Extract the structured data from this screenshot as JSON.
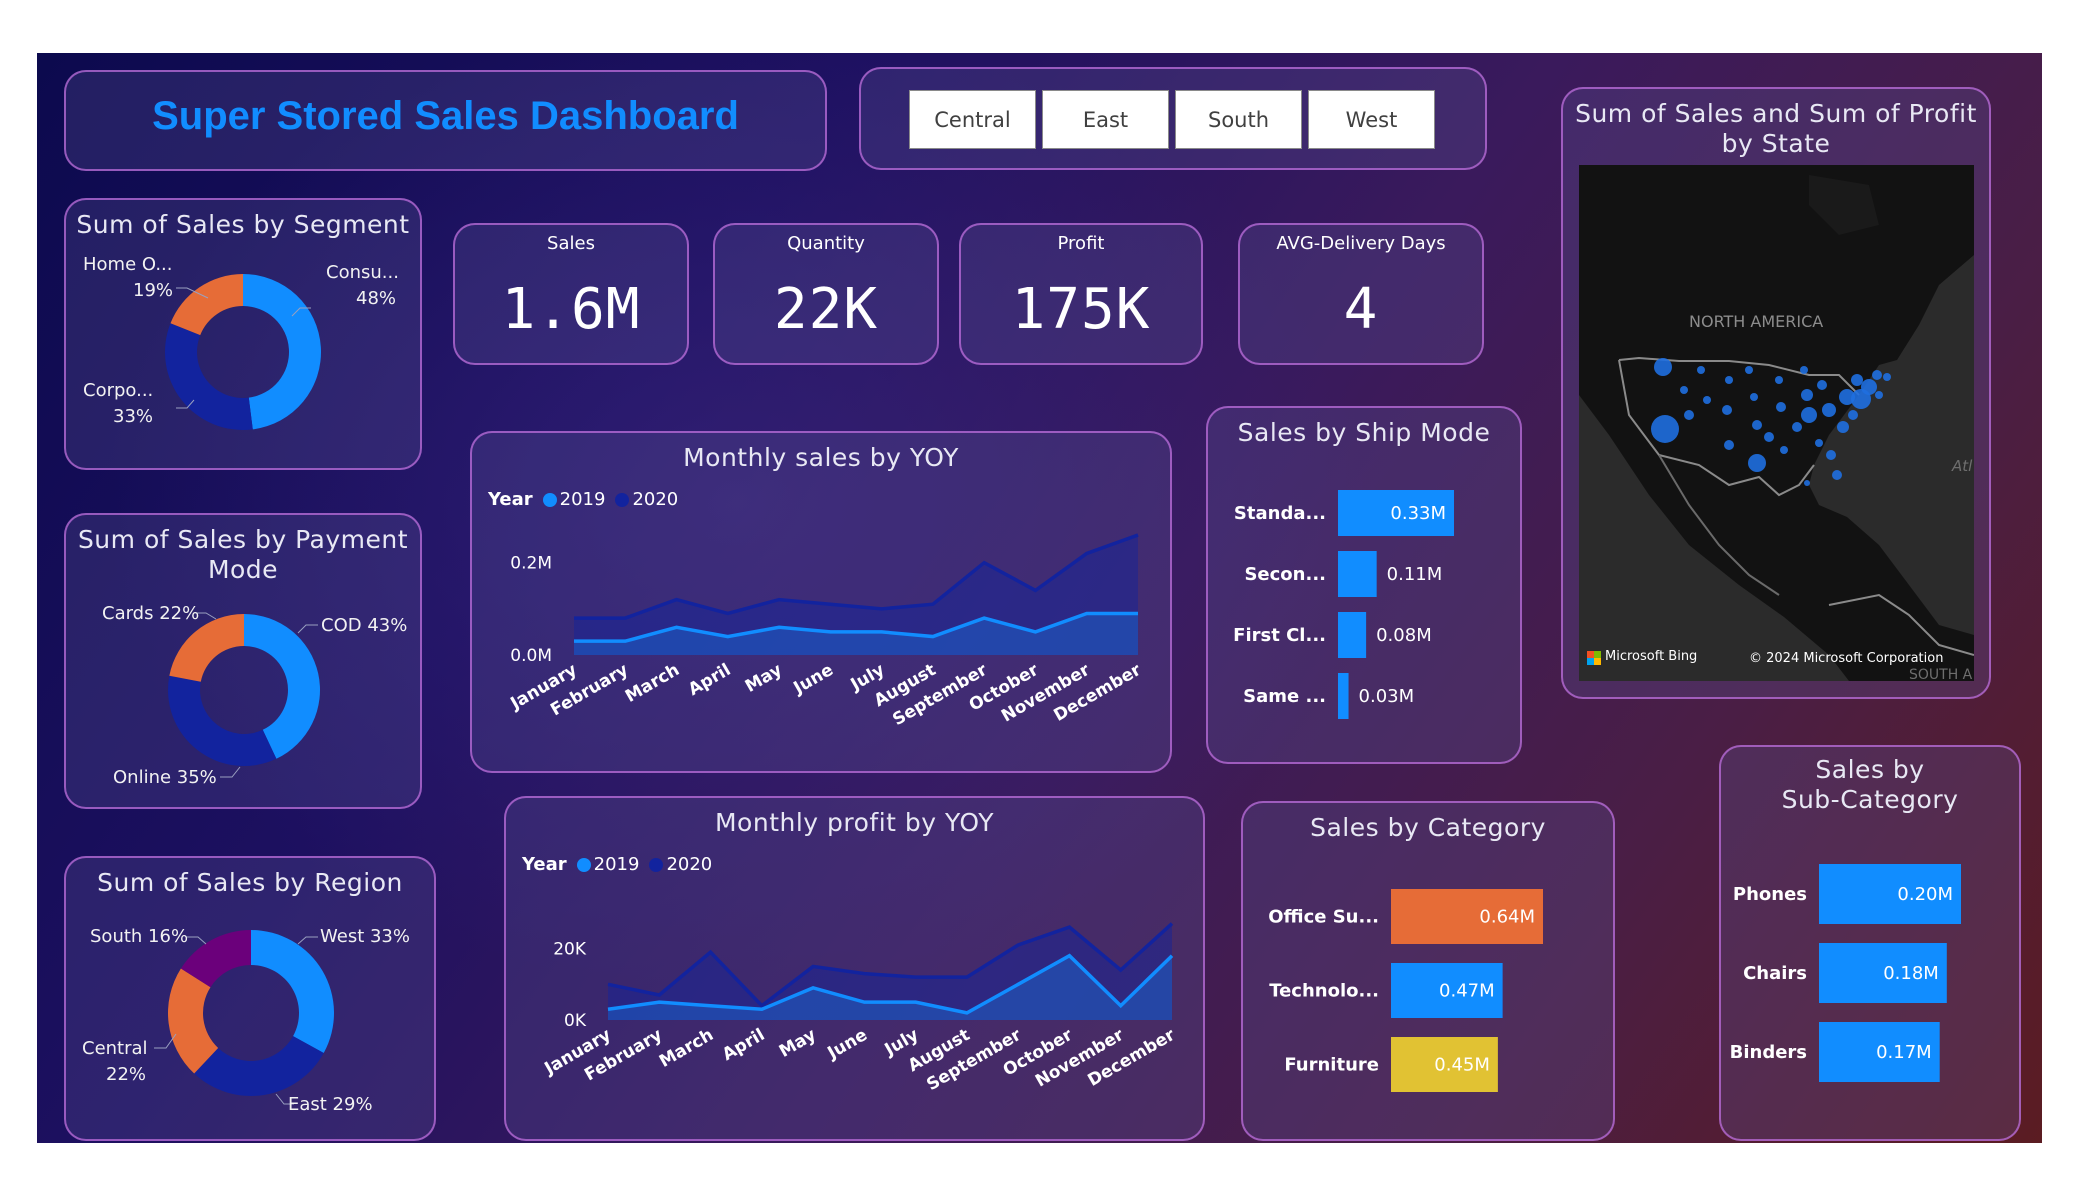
{
  "title": "Super Stored Sales Dashboard",
  "slicer": {
    "options": [
      "Central",
      "East",
      "South",
      "West"
    ]
  },
  "kpis": [
    {
      "label": "Sales",
      "value": "1.6M"
    },
    {
      "label": "Quantity",
      "value": "22K"
    },
    {
      "label": "Profit",
      "value": "175K"
    },
    {
      "label": "AVG-Delivery Days",
      "value": "4"
    }
  ],
  "colors": {
    "blue": "#118dff",
    "navy": "#12239e",
    "orange": "#e66c37",
    "purple": "#6b007b",
    "yellow": "#e1c233"
  },
  "segment": {
    "title": "Sum of Sales by Segment",
    "labels": [
      {
        "name": "Consu...",
        "pct": "48%"
      },
      {
        "name": "Corpo...",
        "pct": "33%"
      },
      {
        "name": "Home O...",
        "pct": "19%"
      }
    ]
  },
  "payment": {
    "title_line1": "Sum of Sales by Payment",
    "title_line2": "Mode",
    "labels": [
      "COD 43%",
      "Online 35%",
      "Cards 22%"
    ]
  },
  "region": {
    "title": "Sum of Sales by Region",
    "labels": {
      "west": "West 33%",
      "east": "East 29%",
      "central_name": "Central",
      "central_pct": "22%",
      "south": "South 16%"
    }
  },
  "sales_yoy": {
    "title": "Monthly sales by YOY",
    "legend_title": "Year",
    "series_names": [
      "2019",
      "2020"
    ],
    "ticks": [
      "0.2M",
      "0.0M"
    ]
  },
  "profit_yoy": {
    "title": "Monthly profit by YOY",
    "legend_title": "Year",
    "series_names": [
      "2019",
      "2020"
    ],
    "ticks": [
      "20K",
      "0K"
    ]
  },
  "ship_mode": {
    "title": "Sales by Ship Mode",
    "categories": [
      "Standa...",
      "Secon...",
      "First Cl...",
      "Same ..."
    ],
    "value_labels": [
      "0.33M",
      "0.11M",
      "0.08M",
      "0.03M"
    ]
  },
  "category": {
    "title": "Sales by Category",
    "categories": [
      "Office Su...",
      "Technolo...",
      "Furniture"
    ],
    "value_labels": [
      "0.64M",
      "0.47M",
      "0.45M"
    ]
  },
  "subcategory": {
    "title_line1": "Sales by",
    "title_line2": "Sub-Category",
    "categories": [
      "Phones",
      "Chairs",
      "Binders"
    ],
    "value_labels": [
      "0.20M",
      "0.18M",
      "0.17M"
    ]
  },
  "map": {
    "title_line1": "Sum of Sales and Sum of Profit",
    "title_line2": "by State",
    "region_label": "NORTH AMERICA",
    "ocean_label": "Atl",
    "south_label": "SOUTH A",
    "bing_label": "Microsoft Bing",
    "copyright": "© 2024 Microsoft Corporation"
  },
  "chart_data": [
    {
      "type": "pie",
      "title": "Sum of Sales by Segment",
      "categories": [
        "Consumer",
        "Corporate",
        "Home Office"
      ],
      "values": [
        48,
        33,
        19
      ]
    },
    {
      "type": "pie",
      "title": "Sum of Sales by Payment Mode",
      "categories": [
        "COD",
        "Online",
        "Cards"
      ],
      "values": [
        43,
        35,
        22
      ]
    },
    {
      "type": "pie",
      "title": "Sum of Sales by Region",
      "categories": [
        "West",
        "East",
        "Central",
        "South"
      ],
      "values": [
        33,
        29,
        22,
        16
      ]
    },
    {
      "type": "area",
      "title": "Monthly sales by YOY",
      "x": [
        "January",
        "February",
        "March",
        "April",
        "May",
        "June",
        "July",
        "August",
        "September",
        "October",
        "November",
        "December"
      ],
      "series": [
        {
          "name": "2019",
          "values": [
            0.03,
            0.03,
            0.06,
            0.04,
            0.06,
            0.05,
            0.05,
            0.04,
            0.08,
            0.05,
            0.09,
            0.09
          ]
        },
        {
          "name": "2020",
          "values": [
            0.08,
            0.08,
            0.12,
            0.09,
            0.12,
            0.11,
            0.1,
            0.11,
            0.2,
            0.14,
            0.22,
            0.26
          ]
        }
      ],
      "ylim": [
        0,
        0.26
      ]
    },
    {
      "type": "area",
      "title": "Monthly profit by YOY",
      "x": [
        "January",
        "February",
        "March",
        "April",
        "May",
        "June",
        "July",
        "August",
        "September",
        "October",
        "November",
        "December"
      ],
      "series": [
        {
          "name": "2019",
          "values": [
            3,
            5,
            4,
            3,
            9,
            5,
            5,
            2,
            10,
            18,
            4,
            18
          ]
        },
        {
          "name": "2020",
          "values": [
            10,
            7,
            19,
            4,
            15,
            13,
            12,
            12,
            21,
            26,
            14,
            27
          ]
        }
      ],
      "ylim": [
        0,
        28
      ]
    },
    {
      "type": "bar",
      "title": "Sales by Ship Mode",
      "categories": [
        "Standa...",
        "Secon...",
        "First Cl...",
        "Same ..."
      ],
      "values": [
        0.33,
        0.11,
        0.08,
        0.03
      ]
    },
    {
      "type": "bar",
      "title": "Sales by Category",
      "categories": [
        "Office Su...",
        "Technolo...",
        "Furniture"
      ],
      "values": [
        0.64,
        0.47,
        0.45
      ]
    },
    {
      "type": "bar",
      "title": "Sales by Sub-Category",
      "categories": [
        "Phones",
        "Chairs",
        "Binders"
      ],
      "values": [
        0.2,
        0.18,
        0.17
      ]
    }
  ]
}
